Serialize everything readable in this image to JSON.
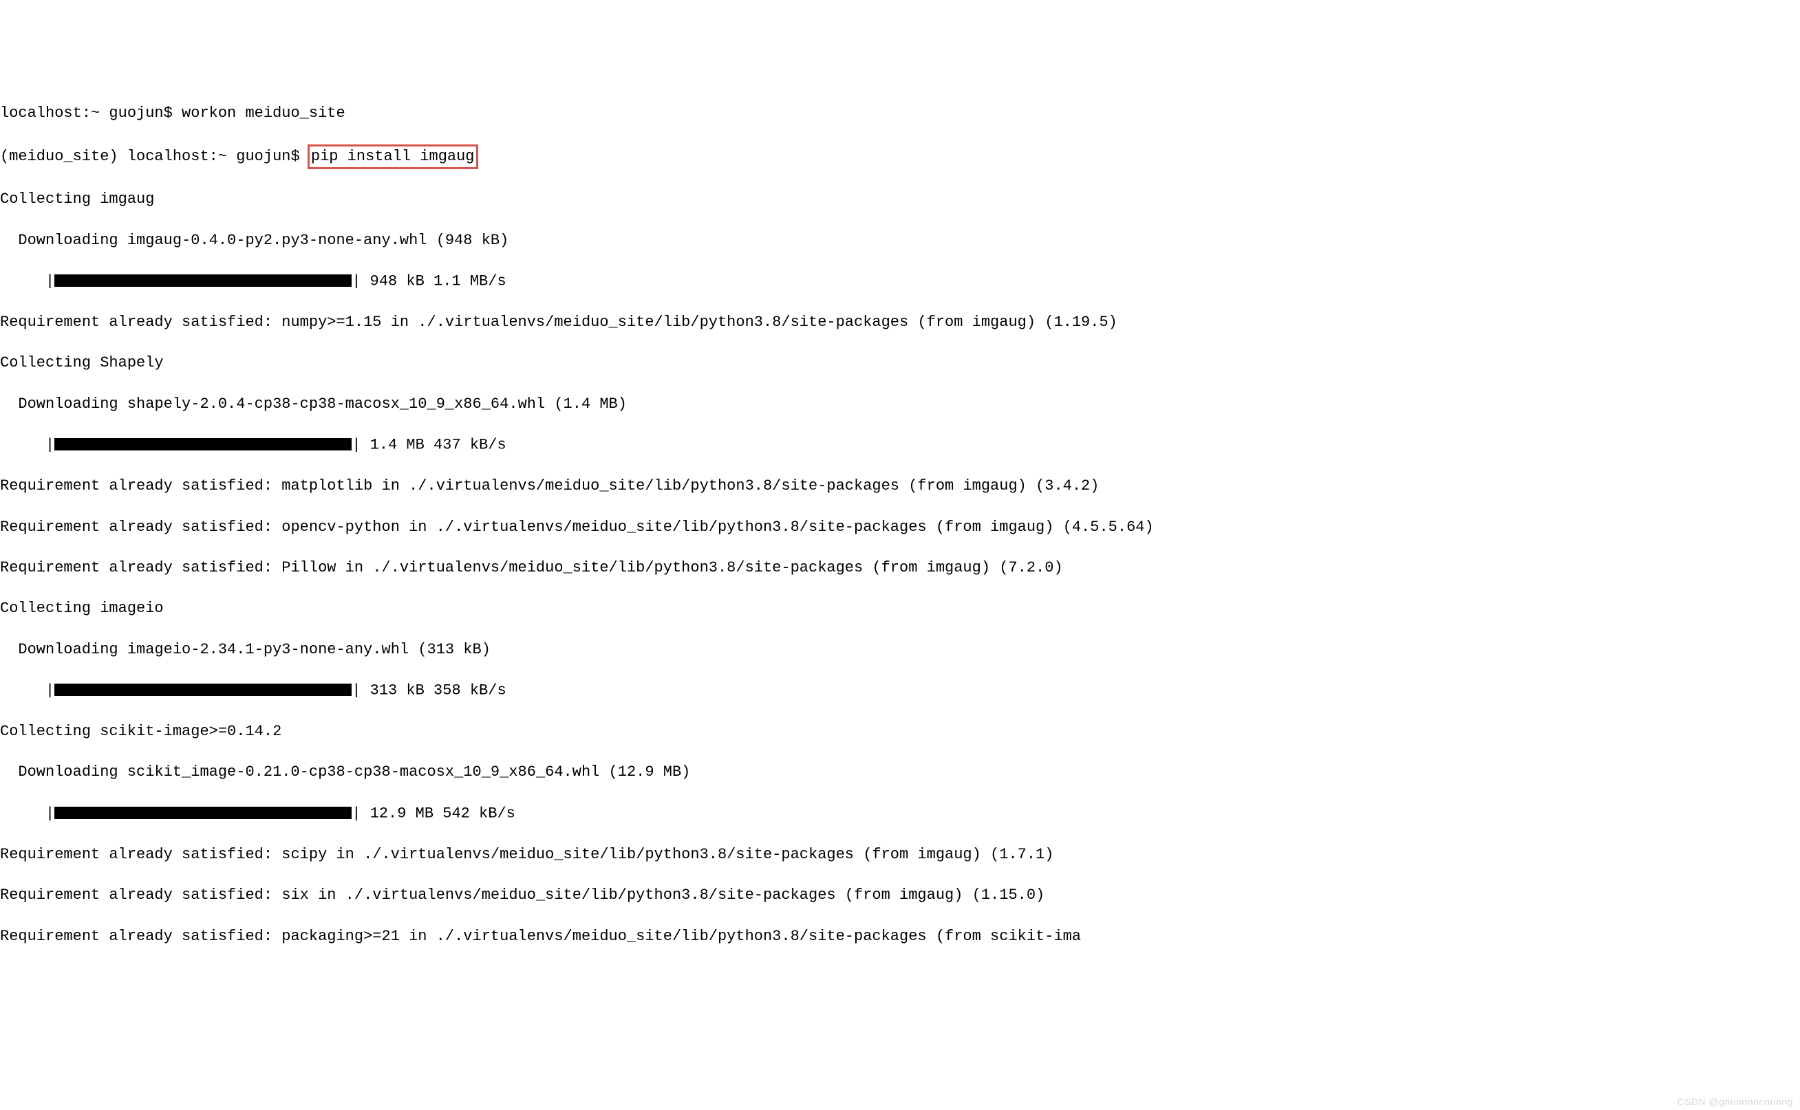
{
  "lines": {
    "l1_prompt": "localhost:~ guojun$ ",
    "l1_cmd": "workon meiduo_site",
    "l2_prompt": "(meiduo_site) localhost:~ guojun$ ",
    "l2_cmd": "pip install imgaug",
    "l3": "Collecting imgaug",
    "l4": "  Downloading imgaug-0.4.0-py2.py3-none-any.whl (948 kB)",
    "l5_prefix": "     |",
    "l5_suffix": "| 948 kB 1.1 MB/s",
    "l6": "Requirement already satisfied: numpy>=1.15 in ./.virtualenvs/meiduo_site/lib/python3.8/site-packages (from imgaug) (1.19.5)",
    "l7": "Collecting Shapely",
    "l8": "  Downloading shapely-2.0.4-cp38-cp38-macosx_10_9_x86_64.whl (1.4 MB)",
    "l9_prefix": "     |",
    "l9_suffix": "| 1.4 MB 437 kB/s",
    "l10": "Requirement already satisfied: matplotlib in ./.virtualenvs/meiduo_site/lib/python3.8/site-packages (from imgaug) (3.4.2)",
    "l11": "Requirement already satisfied: opencv-python in ./.virtualenvs/meiduo_site/lib/python3.8/site-packages (from imgaug) (4.5.5.64)",
    "l12": "Requirement already satisfied: Pillow in ./.virtualenvs/meiduo_site/lib/python3.8/site-packages (from imgaug) (7.2.0)",
    "l13": "Collecting imageio",
    "l14": "  Downloading imageio-2.34.1-py3-none-any.whl (313 kB)",
    "l15_prefix": "     |",
    "l15_suffix": "| 313 kB 358 kB/s",
    "l16": "Collecting scikit-image>=0.14.2",
    "l17": "  Downloading scikit_image-0.21.0-cp38-cp38-macosx_10_9_x86_64.whl (12.9 MB)",
    "l18_prefix": "     |",
    "l18_suffix": "| 12.9 MB 542 kB/s",
    "l19": "Requirement already satisfied: scipy in ./.virtualenvs/meiduo_site/lib/python3.8/site-packages (from imgaug) (1.7.1)",
    "l20": "Requirement already satisfied: six in ./.virtualenvs/meiduo_site/lib/python3.8/site-packages (from imgaug) (1.15.0)",
    "l21": "Requirement already satisfied: packaging>=21 in ./.virtualenvs/meiduo_site/lib/python3.8/site-packages (from scikit-ima"
  },
  "watermark": "CSDN @gnnnnnnnnnnng"
}
